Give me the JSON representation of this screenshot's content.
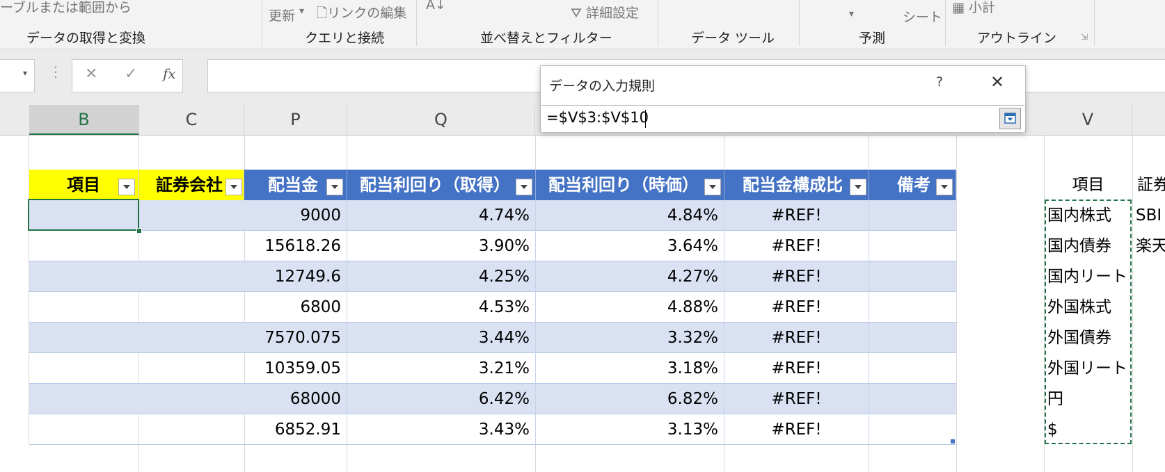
{
  "ribbon": {
    "groups": [
      {
        "label": "データの取得と変換"
      },
      {
        "label": "クエリと接続"
      },
      {
        "label": "並べ替えとフィルター"
      },
      {
        "label": "データ ツール"
      },
      {
        "label": "予測"
      },
      {
        "label": "アウトライン"
      }
    ],
    "faded": {
      "from_table": "ーブルまたは範囲から",
      "refresh": "更新",
      "edit_links": "リンクの編集",
      "advanced": "詳細設定",
      "sheet": "シート",
      "subtotal": "小計"
    }
  },
  "formula_bar": {
    "fx": "fx",
    "cancel": "✕",
    "enter": "✓"
  },
  "columns": [
    "B",
    "C",
    "P",
    "Q",
    "V"
  ],
  "table": {
    "headers": [
      "項目",
      "証券会社",
      "配当金",
      "配当利回り（取得）",
      "配当利回り（時価）",
      "配当金構成比",
      "備考"
    ],
    "rows": [
      {
        "dividend": "9000",
        "yield_cost": "4.74%",
        "yield_market": "4.84%",
        "ratio": "#REF!"
      },
      {
        "dividend": "15618.26",
        "yield_cost": "3.90%",
        "yield_market": "3.64%",
        "ratio": "#REF!"
      },
      {
        "dividend": "12749.6",
        "yield_cost": "4.25%",
        "yield_market": "4.27%",
        "ratio": "#REF!"
      },
      {
        "dividend": "6800",
        "yield_cost": "4.53%",
        "yield_market": "4.88%",
        "ratio": "#REF!"
      },
      {
        "dividend": "7570.075",
        "yield_cost": "3.44%",
        "yield_market": "3.32%",
        "ratio": "#REF!"
      },
      {
        "dividend": "10359.05",
        "yield_cost": "3.21%",
        "yield_market": "3.18%",
        "ratio": "#REF!"
      },
      {
        "dividend": "68000",
        "yield_cost": "6.42%",
        "yield_market": "6.82%",
        "ratio": "#REF!"
      },
      {
        "dividend": "6852.91",
        "yield_cost": "3.43%",
        "yield_market": "3.13%",
        "ratio": "#REF!"
      }
    ]
  },
  "list_v": {
    "header": "項目",
    "items": [
      "国内株式",
      "国内債券",
      "国内リート",
      "外国株式",
      "外国債券",
      "外国リート",
      "円",
      "$"
    ]
  },
  "list_w": {
    "header": "証券",
    "items": [
      "SBI",
      "楽天"
    ]
  },
  "dialog": {
    "title": "データの入力規則",
    "help": "?",
    "close": "✕",
    "reference": "=$V$3:$V$10"
  },
  "colors": {
    "header_blue": "#4472c4",
    "band_blue": "#d9e1f2",
    "header_yellow": "#ffff00",
    "excel_green": "#217346"
  }
}
